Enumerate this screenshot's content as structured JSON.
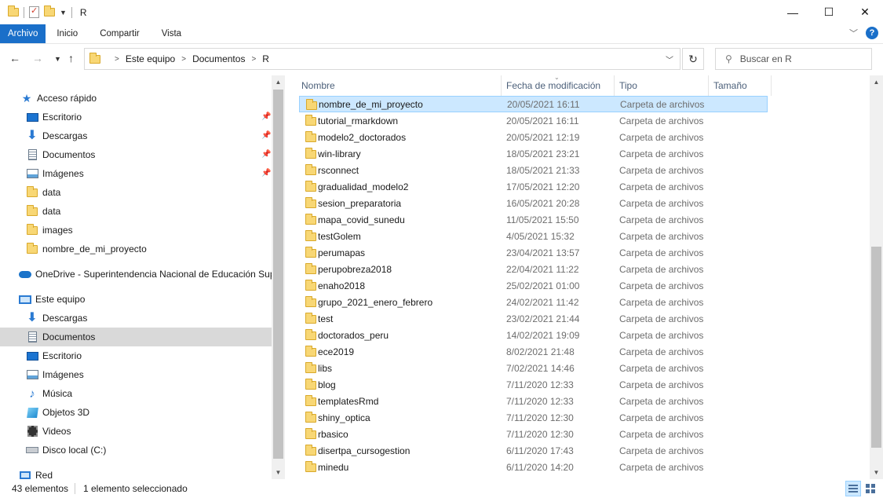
{
  "window": {
    "title": "R",
    "controls": {
      "minimize": "—",
      "maximize": "☐",
      "close": "✕"
    }
  },
  "ribbon": {
    "tabs": [
      "Archivo",
      "Inicio",
      "Compartir",
      "Vista"
    ],
    "help": "?"
  },
  "address": {
    "crumbs": [
      "Este equipo",
      "Documentos",
      "R"
    ]
  },
  "search": {
    "placeholder": "Buscar en R"
  },
  "navpane": {
    "quick_access": "Acceso rápido",
    "quick_items": [
      {
        "label": "Escritorio",
        "icon": "desktop-icon",
        "pinned": true
      },
      {
        "label": "Descargas",
        "icon": "download-icon",
        "pinned": true
      },
      {
        "label": "Documentos",
        "icon": "document-icon",
        "pinned": true
      },
      {
        "label": "Imágenes",
        "icon": "image-icon",
        "pinned": true
      },
      {
        "label": "data",
        "icon": "folder-icon",
        "pinned": false
      },
      {
        "label": "data",
        "icon": "folder-icon",
        "pinned": false
      },
      {
        "label": "images",
        "icon": "folder-icon",
        "pinned": false
      },
      {
        "label": "nombre_de_mi_proyecto",
        "icon": "folder-icon",
        "pinned": false
      }
    ],
    "onedrive": "OneDrive - Superintendencia Nacional de Educación Sup",
    "this_pc": "Este equipo",
    "pc_items": [
      {
        "label": "Descargas",
        "icon": "download-icon"
      },
      {
        "label": "Documentos",
        "icon": "document-icon",
        "selected": true
      },
      {
        "label": "Escritorio",
        "icon": "desktop-icon"
      },
      {
        "label": "Imágenes",
        "icon": "image-icon"
      },
      {
        "label": "Música",
        "icon": "music-icon"
      },
      {
        "label": "Objetos 3D",
        "icon": "3d-objects-icon"
      },
      {
        "label": "Videos",
        "icon": "video-icon"
      },
      {
        "label": "Disco local (C:)",
        "icon": "disk-icon"
      }
    ],
    "network": "Red"
  },
  "filelist": {
    "columns": [
      "Nombre",
      "Fecha de modificación",
      "Tipo",
      "Tamaño"
    ],
    "rows": [
      {
        "name": "nombre_de_mi_proyecto",
        "date": "20/05/2021 16:11",
        "type": "Carpeta de archivos",
        "selected": true
      },
      {
        "name": "tutorial_rmarkdown",
        "date": "20/05/2021 16:11",
        "type": "Carpeta de archivos"
      },
      {
        "name": "modelo2_doctorados",
        "date": "20/05/2021 12:19",
        "type": "Carpeta de archivos"
      },
      {
        "name": "win-library",
        "date": "18/05/2021 23:21",
        "type": "Carpeta de archivos"
      },
      {
        "name": "rsconnect",
        "date": "18/05/2021 21:33",
        "type": "Carpeta de archivos"
      },
      {
        "name": "gradualidad_modelo2",
        "date": "17/05/2021 12:20",
        "type": "Carpeta de archivos"
      },
      {
        "name": "sesion_preparatoria",
        "date": "16/05/2021 20:28",
        "type": "Carpeta de archivos"
      },
      {
        "name": "mapa_covid_sunedu",
        "date": "11/05/2021 15:50",
        "type": "Carpeta de archivos"
      },
      {
        "name": "testGolem",
        "date": "4/05/2021 15:32",
        "type": "Carpeta de archivos"
      },
      {
        "name": "perumapas",
        "date": "23/04/2021 13:57",
        "type": "Carpeta de archivos"
      },
      {
        "name": "perupobreza2018",
        "date": "22/04/2021 11:22",
        "type": "Carpeta de archivos"
      },
      {
        "name": "enaho2018",
        "date": "25/02/2021 01:00",
        "type": "Carpeta de archivos"
      },
      {
        "name": "grupo_2021_enero_febrero",
        "date": "24/02/2021 11:42",
        "type": "Carpeta de archivos"
      },
      {
        "name": "test",
        "date": "23/02/2021 21:44",
        "type": "Carpeta de archivos"
      },
      {
        "name": "doctorados_peru",
        "date": "14/02/2021 19:09",
        "type": "Carpeta de archivos"
      },
      {
        "name": "ece2019",
        "date": "8/02/2021 21:48",
        "type": "Carpeta de archivos"
      },
      {
        "name": "libs",
        "date": "7/02/2021 14:46",
        "type": "Carpeta de archivos"
      },
      {
        "name": "blog",
        "date": "7/11/2020 12:33",
        "type": "Carpeta de archivos"
      },
      {
        "name": "templatesRmd",
        "date": "7/11/2020 12:33",
        "type": "Carpeta de archivos"
      },
      {
        "name": "shiny_optica",
        "date": "7/11/2020 12:30",
        "type": "Carpeta de archivos"
      },
      {
        "name": "rbasico",
        "date": "7/11/2020 12:30",
        "type": "Carpeta de archivos"
      },
      {
        "name": "disertpa_cursogestion",
        "date": "6/11/2020 17:43",
        "type": "Carpeta de archivos"
      },
      {
        "name": "minedu",
        "date": "6/11/2020 14:20",
        "type": "Carpeta de archivos"
      }
    ]
  },
  "status": {
    "count": "43 elementos",
    "selection": "1 elemento seleccionado"
  },
  "colors": {
    "accent": "#1a6fc9",
    "selection": "#cce8ff",
    "folder": "#f8d775"
  }
}
